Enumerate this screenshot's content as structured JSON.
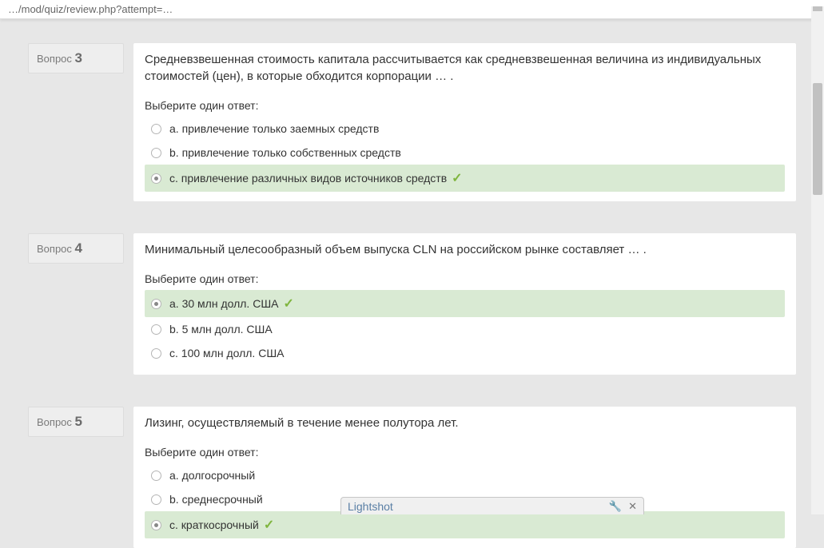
{
  "breadcrumb": "…/mod/quiz/review.php?attempt=…",
  "question_label": "Вопрос",
  "choose_prompt": "Выберите один ответ:",
  "questions": [
    {
      "num": "3",
      "text": "Средневзвешенная стоимость капитала рассчитывается как средневзвешенная величина из индивидуальных стоимостей (цен), в которые обходится корпорации … .",
      "answers": [
        {
          "label": "a. привлечение только заемных средств",
          "correct": false
        },
        {
          "label": "b. привлечение только собственных средств",
          "correct": false
        },
        {
          "label": "c. привлечение различных видов источников средств",
          "correct": true
        }
      ]
    },
    {
      "num": "4",
      "text": "Минимальный целесообразный объем выпуска CLN на российском рынке составляет … .",
      "answers": [
        {
          "label": "a. 30 млн долл. США",
          "correct": true
        },
        {
          "label": "b. 5 млн долл. США",
          "correct": false
        },
        {
          "label": "c. 100 млн долл. США",
          "correct": false
        }
      ]
    },
    {
      "num": "5",
      "text": "Лизинг, осуществляемый в течение менее полутора лет.",
      "answers": [
        {
          "label": "a. долгосрочный",
          "correct": false
        },
        {
          "label": "b. среднесрочный",
          "correct": false
        },
        {
          "label": "c. краткосрочный",
          "correct": true
        }
      ]
    }
  ],
  "lightshot": {
    "label": "Lightshot"
  }
}
